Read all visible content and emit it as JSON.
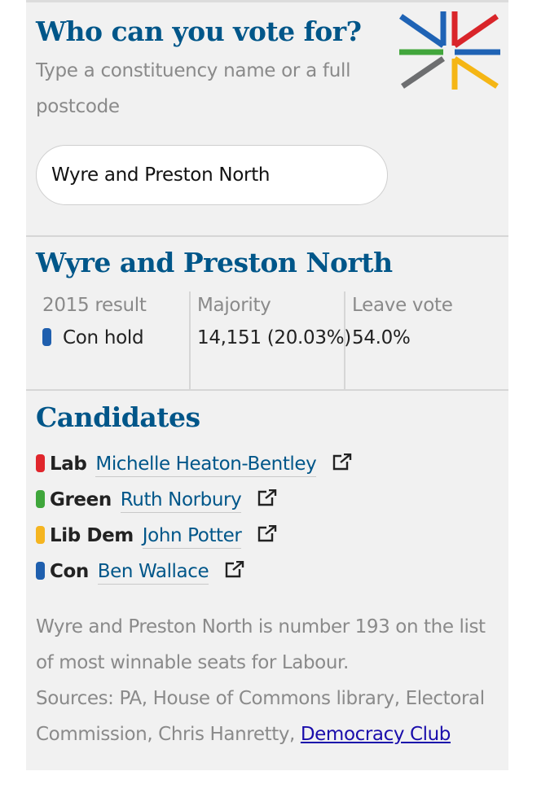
{
  "widget": {
    "title": "Who can you vote for?",
    "subtitle": "Type a constituency name or a full postcode",
    "logo_icon": "election-compass-icon",
    "logo_colors": [
      "#1f63b5",
      "#d9252a",
      "#42a63c",
      "#f5b615",
      "#6d6e70"
    ]
  },
  "search": {
    "value": "Wyre and Preston North",
    "placeholder": ""
  },
  "constituency": {
    "name": "Wyre and Preston North",
    "stats": {
      "result_label": "2015 result",
      "result_value": "Con hold",
      "result_color": "#1f5fae",
      "majority_label": "Majority",
      "majority_value": "14,151 (20.03%)",
      "leave_label": "Leave vote",
      "leave_value": "54.0%"
    }
  },
  "candidates": {
    "title": "Candidates",
    "list": [
      {
        "party": "Lab",
        "name": "Michelle Heaton-Bentley",
        "color": "#e0262c",
        "icon": "external-link-icon"
      },
      {
        "party": "Green",
        "name": "Ruth Norbury",
        "color": "#3fa63b",
        "icon": "external-link-icon"
      },
      {
        "party": "Lib Dem",
        "name": "John Potter",
        "color": "#f5b520",
        "icon": "external-link-icon"
      },
      {
        "party": "Con",
        "name": "Ben Wallace",
        "color": "#1f5fae",
        "icon": "external-link-icon"
      }
    ]
  },
  "footer": {
    "note": "Wyre and Preston North is number 193 on the list of most winnable seats for Labour.",
    "sources_prefix": "Sources: PA, House of Commons library, Electoral Commission, Chris Hanretty, ",
    "sources_link": "Democracy Club"
  }
}
